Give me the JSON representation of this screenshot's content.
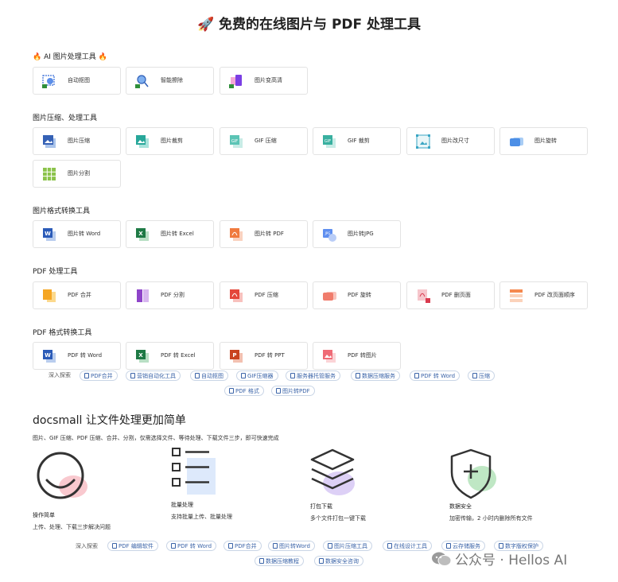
{
  "title": "🚀 免费的在线图片与 PDF 处理工具",
  "sections": [
    {
      "heading": "🔥 AI 图片处理工具 🔥",
      "tools": [
        "自动抠图",
        "智能擦除",
        "图片变高清"
      ]
    },
    {
      "heading": "图片压缩、处理工具",
      "tools": [
        "图片压缩",
        "图片裁剪",
        "GIF 压缩",
        "GIF 裁剪",
        "图片改尺寸",
        "图片旋转",
        "图片分割"
      ]
    },
    {
      "heading": "图片格式转换工具",
      "tools": [
        "图片转 Word",
        "图片转 Excel",
        "图片转 PDF",
        "图片转JPG"
      ]
    },
    {
      "heading": "PDF 处理工具",
      "tools": [
        "PDF 合并",
        "PDF 分割",
        "PDF 压缩",
        "PDF 旋转",
        "PDF 删页面",
        "PDF 改页面顺序"
      ]
    },
    {
      "heading": "PDF 格式转换工具",
      "tools": [
        "PDF 转 Word",
        "PDF 转 Excel",
        "PDF 转 PPT",
        "PDF 转图片"
      ]
    }
  ],
  "explore1": {
    "label": "深入探索",
    "chips": [
      "PDF合并",
      "营销自动化工具",
      "自动抠图",
      "GIF压缩器",
      "服务器托管服务",
      "数据压缩服务",
      "PDF 转 Word",
      "压缩",
      "PDF 格式",
      "图片转PDF"
    ]
  },
  "intro": {
    "heading": "docsmall 让文件处理更加简单",
    "desc": "图片、GIF 压缩、PDF 压缩、合并、分割，仅需选择文件、等待处理、下载文件三步，即可快速完成"
  },
  "features": [
    {
      "title": "操作简单",
      "desc": "上传、处理、下载三步解决问题"
    },
    {
      "title": "批量处理",
      "desc": "支持批量上传、批量处理"
    },
    {
      "title": "打包下载",
      "desc": "多个文件打包一键下载"
    },
    {
      "title": "数据安全",
      "desc": "加密传输，2 小时内删除所有文件"
    }
  ],
  "explore2": {
    "label": "深入探索",
    "chips": [
      "PDF 编辑软件",
      "PDF 转 Word",
      "PDF合并",
      "图片转Word",
      "图片压缩工具",
      "在线设计工具",
      "云存储服务",
      "数字版权保护",
      "数据压缩教程",
      "数据安全咨询"
    ]
  },
  "watermark": "公众号 · Hellos AI",
  "colors": {
    "chip_text": "#3b64a8",
    "border": "#e3e3e3",
    "accent_green": "#7cc576",
    "accent_pink": "#f7a8b2"
  }
}
